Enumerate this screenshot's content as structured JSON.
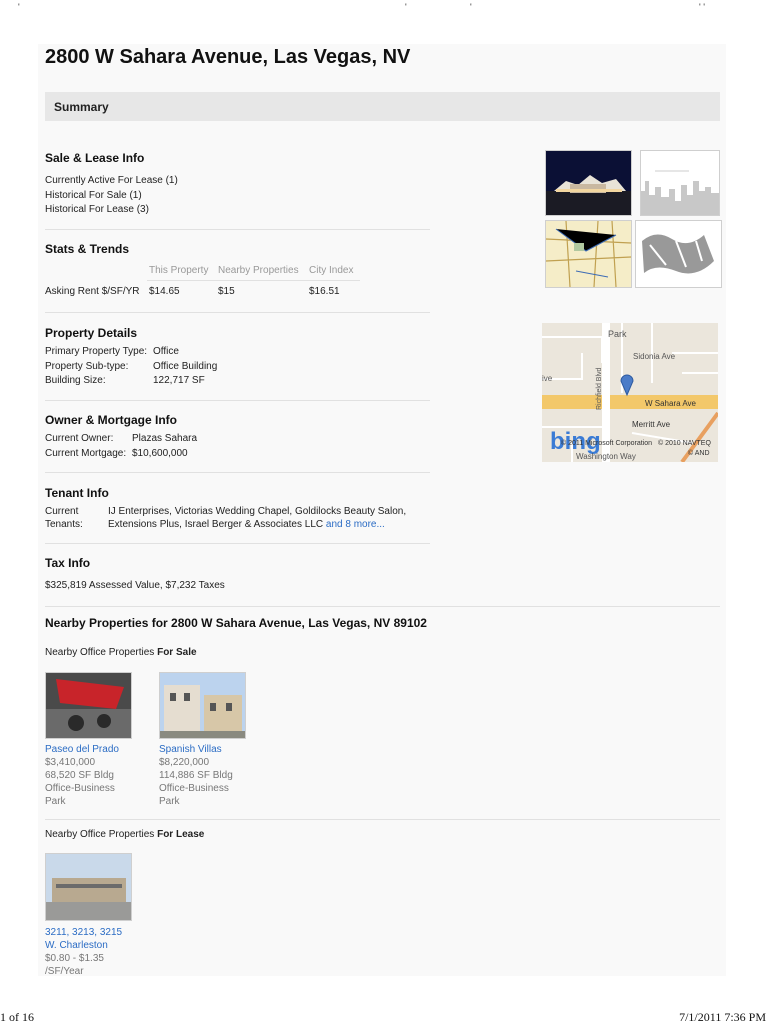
{
  "page_title": "2800 W Sahara Avenue, Las Vegas, NV",
  "summary_label": "Summary",
  "sale_lease": {
    "title": "Sale & Lease Info",
    "lines": [
      "Currently Active For Lease (1)",
      "Historical For Sale (1)",
      "Historical For Lease (3)"
    ]
  },
  "stats": {
    "title": "Stats & Trends",
    "headers": [
      "This Property",
      "Nearby Properties",
      "City Index"
    ],
    "row_label": "Asking Rent $/SF/YR",
    "values": [
      "$14.65",
      "$15",
      "$16.51"
    ]
  },
  "property_details": {
    "title": "Property Details",
    "rows": [
      {
        "k": "Primary Property Type:",
        "v": "Office"
      },
      {
        "k": "Property Sub-type:",
        "v": "Office Building"
      },
      {
        "k": "Building Size:",
        "v": "122,717 SF"
      }
    ]
  },
  "owner": {
    "title": "Owner & Mortgage Info",
    "rows": [
      {
        "k": "Current Owner:",
        "v": "Plazas Sahara"
      },
      {
        "k": "Current Mortgage:",
        "v": "$10,600,000"
      }
    ]
  },
  "tenant": {
    "title": "Tenant Info",
    "label1": "Current",
    "label2": "Tenants:",
    "text1": "IJ Enterprises, Victorias Wedding Chapel, Goldilocks Beauty Salon,",
    "text2": "Extensions Plus, Israel Berger & Associates LLC",
    "more": "and 8 more..."
  },
  "tax": {
    "title": "Tax Info",
    "text": "$325,819 Assessed Value, $7,232 Taxes"
  },
  "map": {
    "streets": [
      "Park",
      "Sidonia Ave",
      "W Sahara Ave",
      "Merritt Ave",
      "Richfield Blvd",
      "Washington Way",
      "ive"
    ],
    "copyright1": "© 2011 Microsoft Corporation",
    "copyright2": "© 2010 NAVTEQ",
    "copyright3": "© AND",
    "logo": "bing"
  },
  "nearby": {
    "title": "Nearby Properties for 2800 W Sahara Avenue, Las Vegas, NV 89102",
    "sale_prefix": "Nearby Office Properties",
    "sale_suffix": "For Sale",
    "lease_prefix": "Nearby Office Properties",
    "lease_suffix": "For Lease",
    "sale_props": [
      {
        "name": "Paseo del Prado",
        "price": "$3,410,000",
        "size": "68,520 SF Bldg",
        "type1": "Office-Business",
        "type2": "Park"
      },
      {
        "name": "Spanish Villas",
        "price": "$8,220,000",
        "size": "114,886 SF Bldg",
        "type1": "Office-Business",
        "type2": "Park"
      }
    ],
    "lease_props": [
      {
        "name1": "3211, 3213, 3215",
        "name2": "W. Charleston",
        "price": "$0.80 - $1.35",
        "unit": "/SF/Year"
      }
    ]
  },
  "footer": {
    "page": "1 of 16",
    "datetime": "7/1/2011 7:36 PM"
  },
  "colors": {
    "link": "#2b6cc4",
    "summary_bg": "#e7e7e7",
    "map_road": "#f3c86a"
  }
}
